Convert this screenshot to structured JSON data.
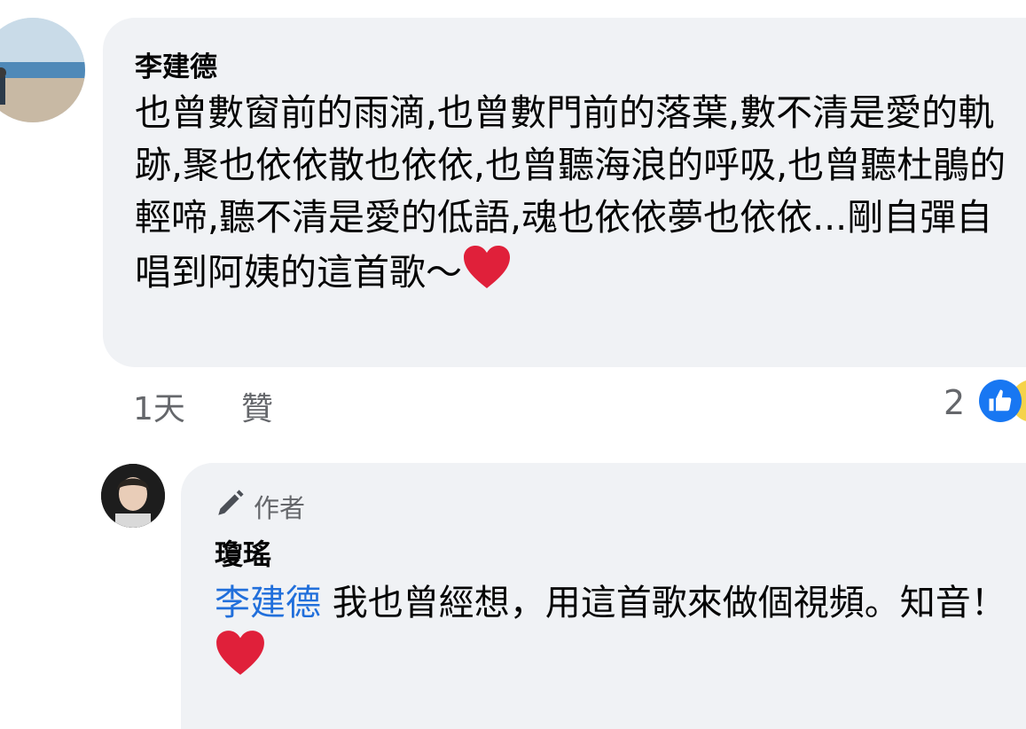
{
  "comment": {
    "author": "李建德",
    "text": "也曾數窗前的雨滴,也曾數門前的落葉,數不清是愛的軌跡,聚也依依散也依依,也曾聽海浪的呼吸,也曾聽杜鵑的輕啼,聽不清是愛的低語,魂也依依夢也依依...剛自彈自唱到阿姨的這首歌～",
    "time": "1天",
    "like_label": "贊",
    "reaction_count": "2"
  },
  "reply": {
    "badge": "作者",
    "author": "瓊瑤",
    "mention": "李建德",
    "text": " 我也曾經想，用這首歌來做個視頻。知音！ "
  },
  "colors": {
    "bubble": "#f0f2f5",
    "mention": "#216fdb",
    "meta": "#65676b",
    "like_blue": "#1877f2",
    "heart_red": "#e0203a"
  },
  "icons": [
    "heart-emoji-icon",
    "pen-icon",
    "like-icon"
  ]
}
